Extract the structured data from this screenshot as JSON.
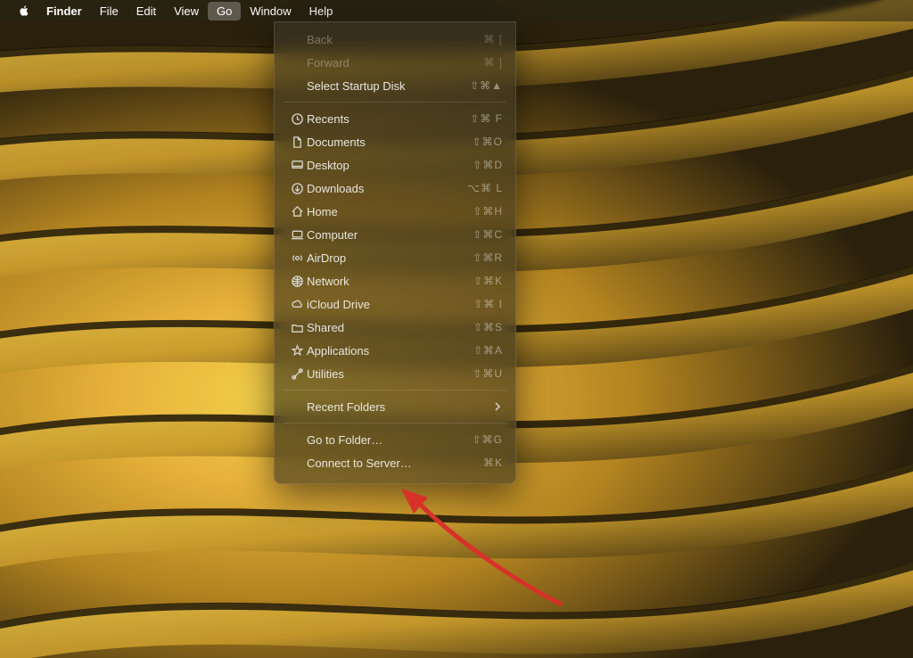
{
  "menubar": {
    "app_name": "Finder",
    "items": [
      "File",
      "Edit",
      "View",
      "Go",
      "Window",
      "Help"
    ],
    "active_index": 3
  },
  "dropdown": {
    "section1": [
      {
        "label": "Back",
        "shortcut": "⌘ [",
        "disabled": true
      },
      {
        "label": "Forward",
        "shortcut": "⌘ ]",
        "disabled": true
      },
      {
        "label": "Select Startup Disk",
        "shortcut": "⇧⌘▲",
        "disabled": false
      }
    ],
    "section2": [
      {
        "icon": "clock-icon",
        "label": "Recents",
        "shortcut": "⇧⌘ F"
      },
      {
        "icon": "document-icon",
        "label": "Documents",
        "shortcut": "⇧⌘O"
      },
      {
        "icon": "desktop-icon",
        "label": "Desktop",
        "shortcut": "⇧⌘D"
      },
      {
        "icon": "download-icon",
        "label": "Downloads",
        "shortcut": "⌥⌘ L"
      },
      {
        "icon": "home-icon",
        "label": "Home",
        "shortcut": "⇧⌘H"
      },
      {
        "icon": "computer-icon",
        "label": "Computer",
        "shortcut": "⇧⌘C"
      },
      {
        "icon": "airdrop-icon",
        "label": "AirDrop",
        "shortcut": "⇧⌘R"
      },
      {
        "icon": "network-icon",
        "label": "Network",
        "shortcut": "⇧⌘K"
      },
      {
        "icon": "cloud-icon",
        "label": "iCloud Drive",
        "shortcut": "⇧⌘ I"
      },
      {
        "icon": "shared-folder-icon",
        "label": "Shared",
        "shortcut": "⇧⌘S"
      },
      {
        "icon": "applications-icon",
        "label": "Applications",
        "shortcut": "⇧⌘A"
      },
      {
        "icon": "utilities-icon",
        "label": "Utilities",
        "shortcut": "⇧⌘U"
      }
    ],
    "section3": [
      {
        "label": "Recent Folders",
        "submenu": true
      }
    ],
    "section4": [
      {
        "label": "Go to Folder…",
        "shortcut": "⇧⌘G"
      },
      {
        "label": "Connect to Server…",
        "shortcut": "⌘K"
      }
    ]
  },
  "annotation": {
    "arrow_target": "Go to Folder…"
  }
}
